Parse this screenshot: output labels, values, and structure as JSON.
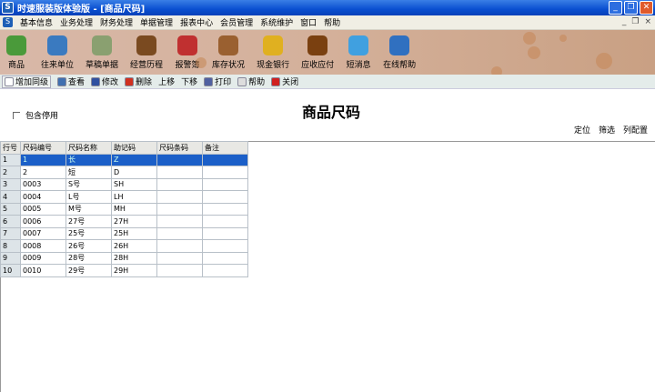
{
  "window": {
    "title": "时速服装版体验版 - [商品尺码]",
    "logo": "S",
    "controls": [
      "_",
      "❐",
      "✕"
    ]
  },
  "menu": [
    "基本信息",
    "业务处理",
    "财务处理",
    "单据管理",
    "报表中心",
    "会员管理",
    "系统维护",
    "窗口",
    "帮助"
  ],
  "mdi_controls": [
    "_",
    "❐",
    "×"
  ],
  "toolbar": [
    {
      "label": "商品",
      "color": "#4a9a3a"
    },
    {
      "label": "往来单位",
      "color": "#3a7ac0"
    },
    {
      "label": "草稿单据",
      "color": "#8aa070"
    },
    {
      "label": "经营历程",
      "color": "#7a4a20"
    },
    {
      "label": "报警簿",
      "color": "#c03030"
    },
    {
      "label": "库存状况",
      "color": "#9a6030"
    },
    {
      "label": "现金银行",
      "color": "#e0b020"
    },
    {
      "label": "应收应付",
      "color": "#7a4010"
    },
    {
      "label": "短消息",
      "color": "#40a0e0"
    },
    {
      "label": "在线帮助",
      "color": "#3070c0"
    }
  ],
  "actions": [
    {
      "label": "增加同级",
      "color": "#fff"
    },
    {
      "label": "查看",
      "color": "#4070b0"
    },
    {
      "label": "修改",
      "color": "#3050a0"
    },
    {
      "label": "删除",
      "color": "#d03020"
    },
    {
      "label": "上移",
      "color": ""
    },
    {
      "label": "下移",
      "color": ""
    },
    {
      "label": "打印",
      "color": "#5060a0"
    },
    {
      "label": "帮助",
      "color": "#ddd"
    },
    {
      "label": "关闭",
      "color": "#d02020"
    }
  ],
  "filter": {
    "include_disabled": "包含停用",
    "checked": false
  },
  "page_title": "商品尺码",
  "right_links": [
    "定位",
    "筛选",
    "列配置"
  ],
  "table": {
    "columns": [
      "行号",
      "尺码编号",
      "尺码名称",
      "助记码",
      "尺码条码",
      "备注"
    ],
    "selected_row": 0,
    "rows": [
      [
        "1",
        "1",
        "长",
        "Z",
        "",
        ""
      ],
      [
        "2",
        "2",
        "短",
        "D",
        "",
        ""
      ],
      [
        "3",
        "0003",
        "S号",
        "SH",
        "",
        ""
      ],
      [
        "4",
        "0004",
        "L号",
        "LH",
        "",
        ""
      ],
      [
        "5",
        "0005",
        "M号",
        "MH",
        "",
        ""
      ],
      [
        "6",
        "0006",
        "27号",
        "27H",
        "",
        ""
      ],
      [
        "7",
        "0007",
        "25号",
        "25H",
        "",
        ""
      ],
      [
        "8",
        "0008",
        "26号",
        "26H",
        "",
        ""
      ],
      [
        "9",
        "0009",
        "28号",
        "28H",
        "",
        ""
      ],
      [
        "10",
        "0010",
        "29号",
        "29H",
        "",
        ""
      ]
    ]
  }
}
